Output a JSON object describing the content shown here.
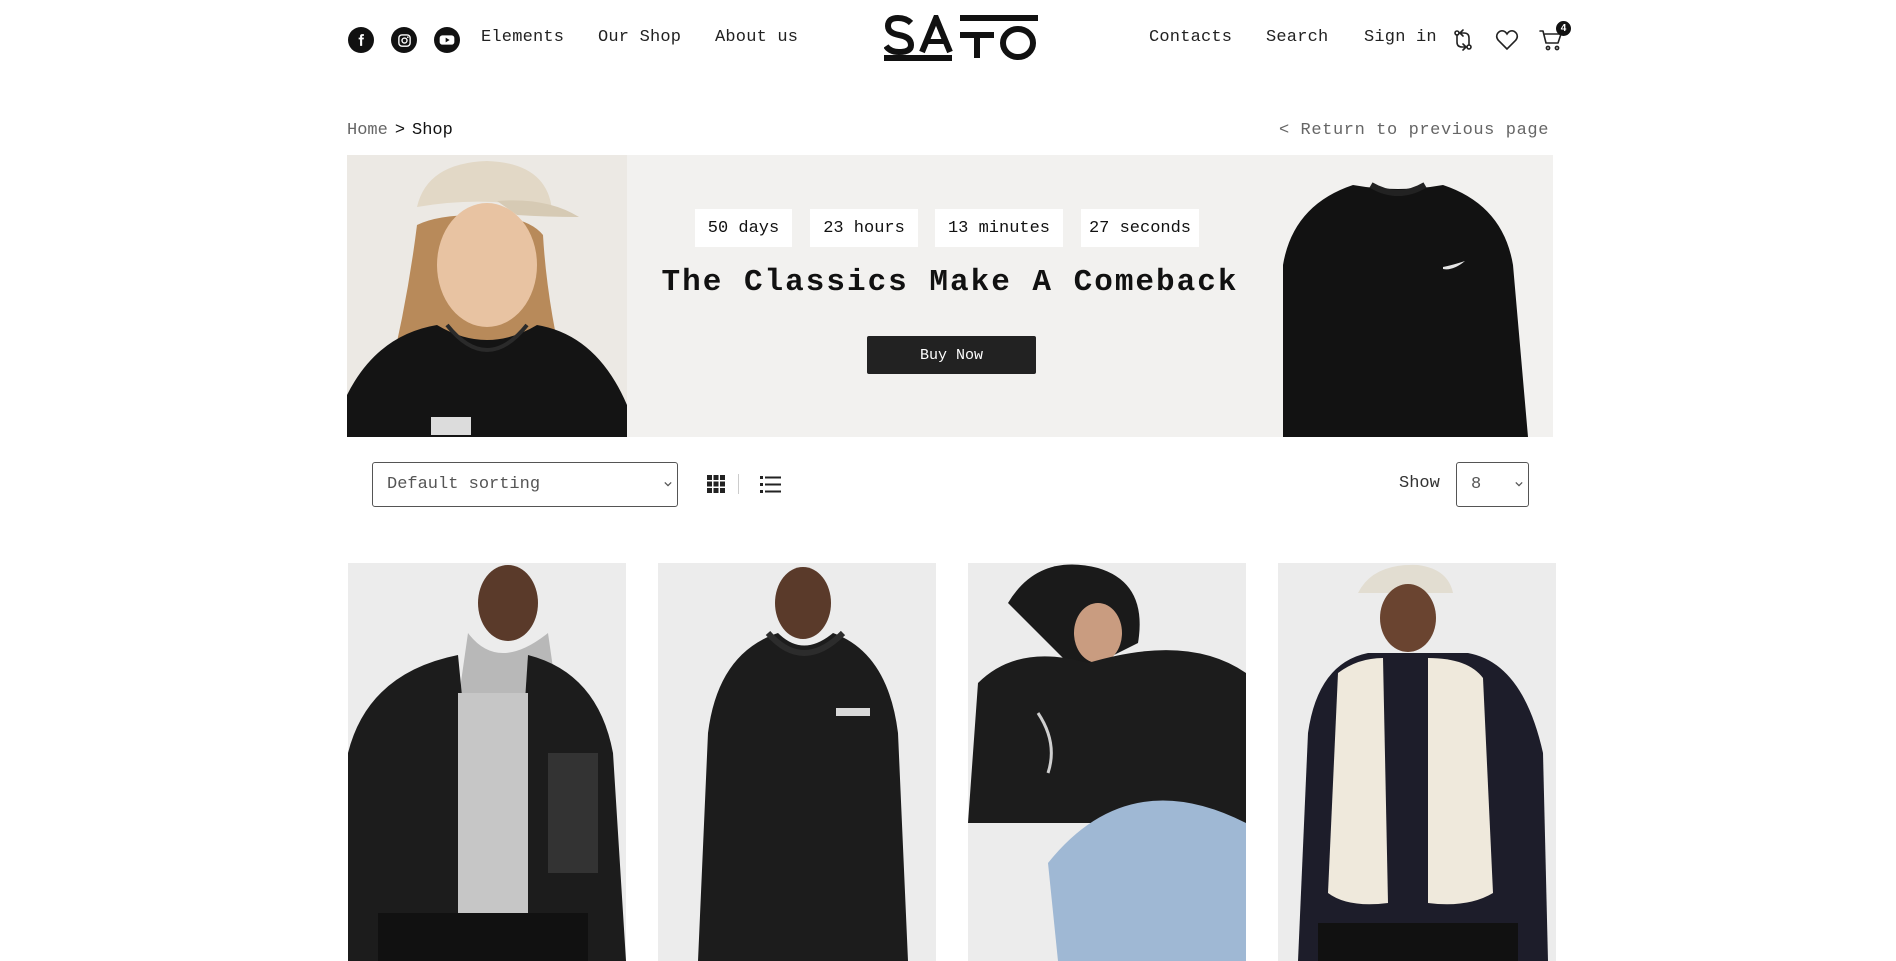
{
  "header": {
    "social": [
      {
        "name": "facebook-icon"
      },
      {
        "name": "instagram-icon"
      },
      {
        "name": "youtube-icon"
      }
    ],
    "nav_left": [
      "Elements",
      "Our Shop",
      "About us"
    ],
    "logo_text": "SATO",
    "nav_right": [
      "Contacts",
      "Search",
      "Sign in"
    ],
    "icons": [
      "compare-icon",
      "heart-icon",
      "cart-icon"
    ],
    "cart_count": "4"
  },
  "breadcrumb": {
    "home": "Home",
    "separator": ">",
    "current": "Shop",
    "return_link": "< Return to previous page"
  },
  "banner": {
    "countdown": [
      "50 days",
      "23 hours",
      "13 minutes",
      "27 seconds"
    ],
    "title": "The Classics Make A Comeback",
    "button": "Buy Now",
    "background": "#f2f1ef"
  },
  "toolbar": {
    "sorting": "Default sorting",
    "views": [
      "grid-view-icon",
      "list-view-icon"
    ],
    "show_label": "Show",
    "show_value": "8"
  },
  "products": [
    {
      "image": "black-fleece-jacket"
    },
    {
      "image": "black-hoodie-terrex"
    },
    {
      "image": "black-graphic-hoodie"
    },
    {
      "image": "cream-fleece-vest"
    }
  ],
  "colors": {
    "text": "#111111",
    "muted": "#666666",
    "button": "#222222"
  }
}
